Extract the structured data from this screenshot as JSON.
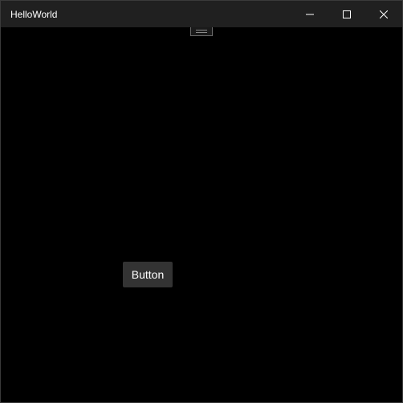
{
  "window": {
    "title": "HelloWorld"
  },
  "caption_buttons": {
    "minimize_icon": "minimize-icon",
    "maximize_icon": "maximize-icon",
    "close_icon": "close-icon"
  },
  "main": {
    "button_label": "Button"
  },
  "colors": {
    "titlebar": "#202020",
    "content_background": "#000000",
    "button_background": "#333333",
    "text": "#ffffff"
  }
}
